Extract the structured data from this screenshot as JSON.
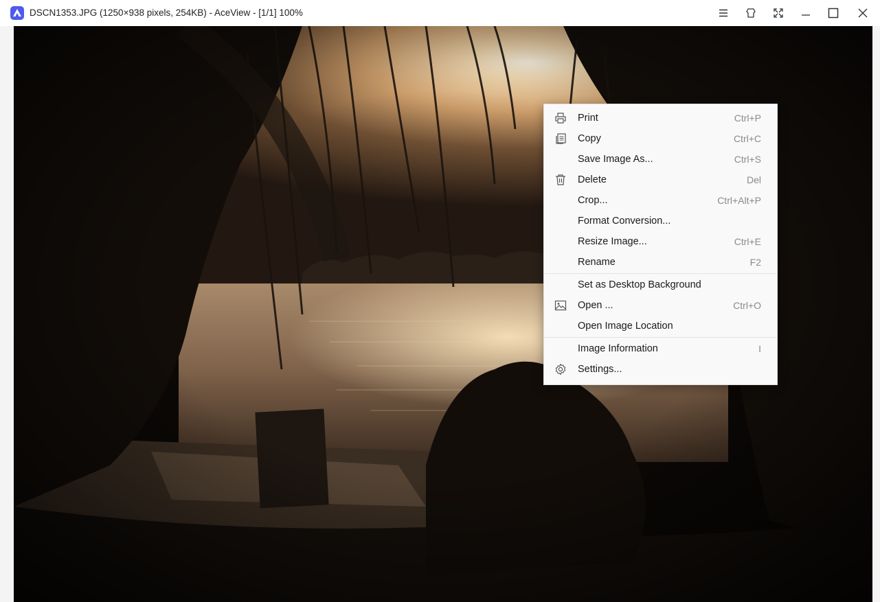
{
  "window": {
    "title": "DSCN1353.JPG (1250×938 pixels, 254KB) - AceView - [1/1] 100%",
    "accent": "#4d5bf0"
  },
  "titlebar_buttons": [
    {
      "name": "menu-icon"
    },
    {
      "name": "pin-icon"
    },
    {
      "name": "fullscreen-icon"
    },
    {
      "name": "minimize-icon"
    },
    {
      "name": "maximize-icon"
    },
    {
      "name": "close-icon"
    }
  ],
  "context_menu": {
    "items": [
      {
        "label": "Print",
        "shortcut": "Ctrl+P",
        "icon": "printer-icon"
      },
      {
        "label": "Copy",
        "shortcut": "Ctrl+C",
        "icon": "copy-icon"
      },
      {
        "label": "Save Image As...",
        "shortcut": "Ctrl+S",
        "icon": ""
      },
      {
        "label": "Delete",
        "shortcut": "Del",
        "icon": "trash-icon"
      },
      {
        "label": "Crop...",
        "shortcut": "Ctrl+Alt+P",
        "icon": ""
      },
      {
        "label": "Format Conversion...",
        "shortcut": "",
        "icon": ""
      },
      {
        "label": "Resize Image...",
        "shortcut": "Ctrl+E",
        "icon": ""
      },
      {
        "label": "Rename",
        "shortcut": "F2",
        "icon": ""
      },
      {
        "label": "Set as Desktop Background",
        "shortcut": "",
        "icon": ""
      },
      {
        "label": "Open ...",
        "shortcut": "Ctrl+O",
        "icon": "image-icon"
      },
      {
        "label": "Open Image Location",
        "shortcut": "",
        "icon": ""
      },
      {
        "label": "Image Information",
        "shortcut": "I",
        "icon": ""
      },
      {
        "label": "Settings...",
        "shortcut": "",
        "icon": "gear-icon"
      }
    ]
  }
}
